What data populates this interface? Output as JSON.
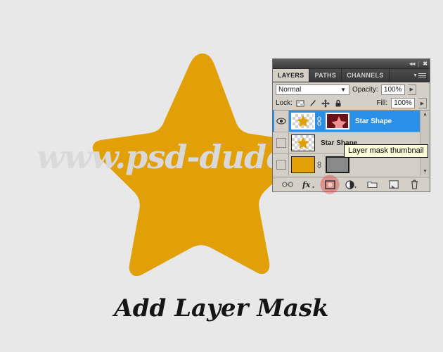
{
  "caption": "Add Layer Mask",
  "watermark": "www.psd-dude",
  "colors": {
    "background": "#e8e8e8",
    "star": "#e2a008",
    "panel": "#d4d0c8",
    "selected_row": "#2a8fe6",
    "highlight": "#e63c3c",
    "tooltip_bg": "#ffffdc",
    "mask_thumb": "#6b1118"
  },
  "panel": {
    "titlebar": {
      "collapse_label": "◂◂",
      "close_label": "✖"
    },
    "tabs": [
      {
        "label": "LAYERS",
        "active": true
      },
      {
        "label": "PATHS",
        "active": false
      },
      {
        "label": "CHANNELS",
        "active": false
      }
    ],
    "menu_icon": "panel-menu-icon",
    "blend_mode": {
      "value": "Normal",
      "caret": "▼"
    },
    "opacity": {
      "label": "Opacity:",
      "value": "100%",
      "spinner": "▶"
    },
    "lock": {
      "label": "Lock:",
      "icons": [
        "lock-transparent-pixels-icon",
        "lock-image-pixels-icon",
        "lock-position-icon",
        "lock-all-icon"
      ]
    },
    "fill": {
      "label": "Fill:",
      "value": "100%",
      "spinner": "▶"
    },
    "layers": [
      {
        "name": "Star Shape",
        "selected": true,
        "visible": true,
        "has_mask": true,
        "linked": true
      },
      {
        "name": "Star Shape",
        "selected": false,
        "visible": false,
        "has_mask": false,
        "linked": false
      },
      {
        "name": "",
        "selected": false,
        "visible": false,
        "has_mask": true,
        "linked": true
      }
    ],
    "scrollbar": {
      "up": "▲",
      "down": "▼"
    },
    "footer_buttons": [
      {
        "name": "link-layers-icon",
        "highlighted": false
      },
      {
        "name": "layer-style-fx-icon",
        "highlighted": false
      },
      {
        "name": "add-layer-mask-icon",
        "highlighted": true
      },
      {
        "name": "new-adjustment-layer-icon",
        "highlighted": false
      },
      {
        "name": "new-group-icon",
        "highlighted": false
      },
      {
        "name": "new-layer-icon",
        "highlighted": false
      },
      {
        "name": "delete-layer-icon",
        "highlighted": false
      }
    ]
  },
  "tooltip": {
    "text": "Layer mask thumbnail"
  }
}
